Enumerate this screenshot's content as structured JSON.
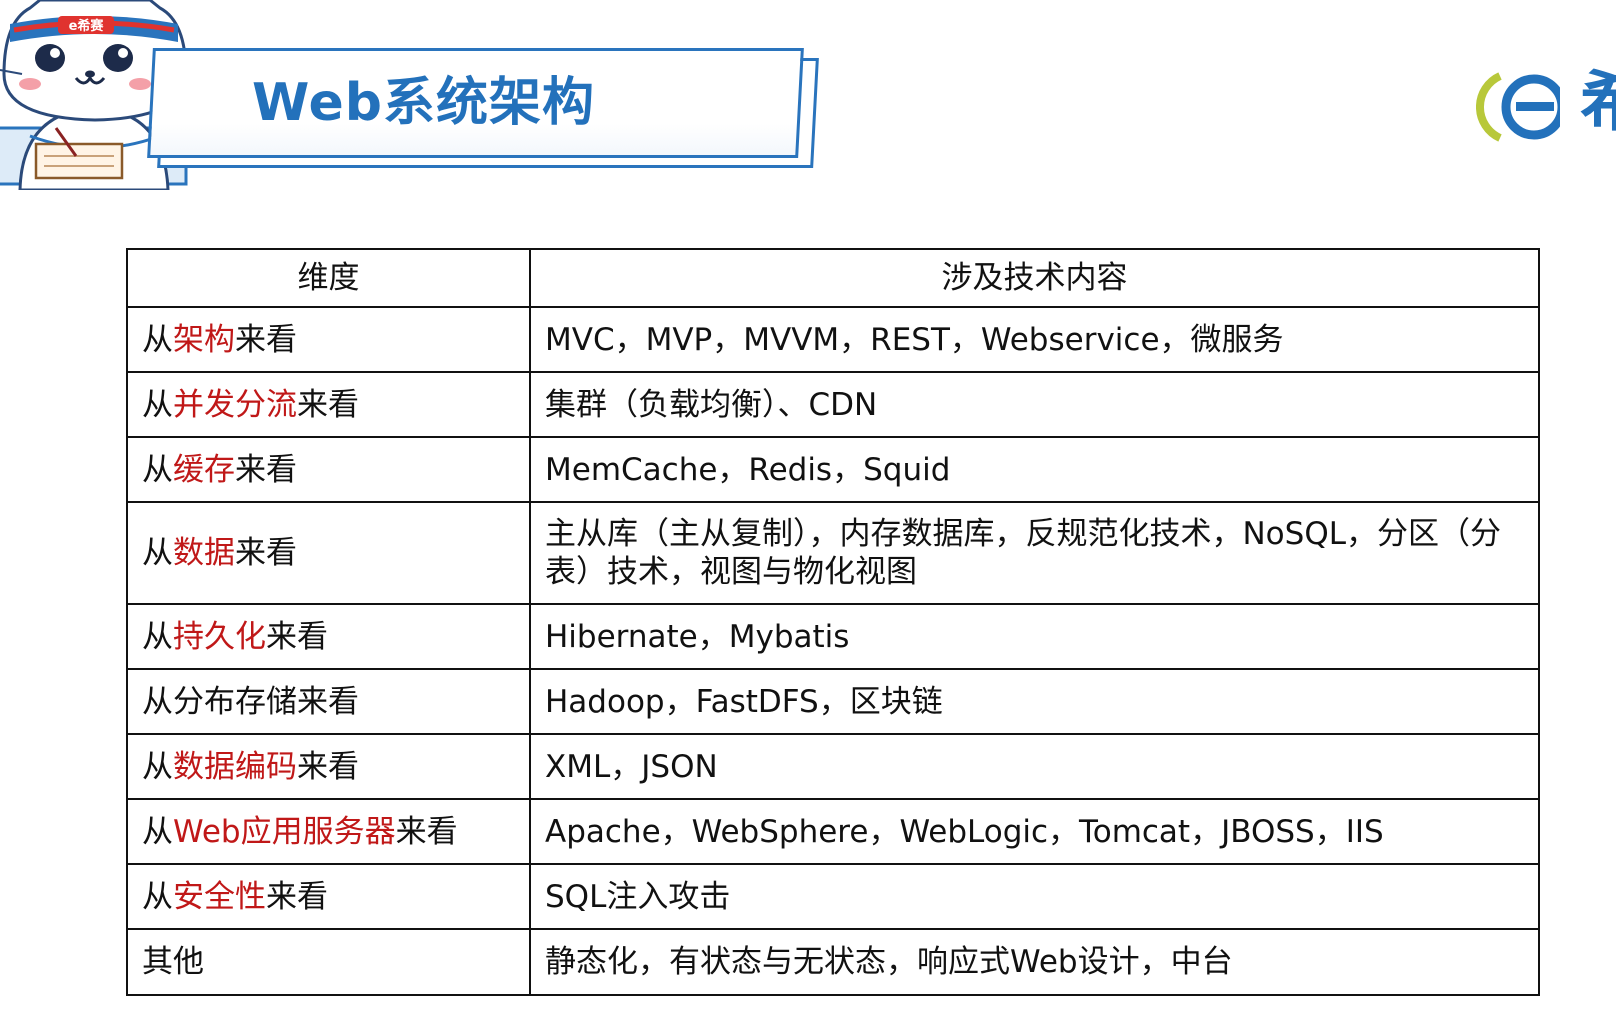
{
  "header": {
    "title": "Web系统架构",
    "mascot_badge": "e希赛",
    "brand_text": "希"
  },
  "colors": {
    "accent_blue": "#2371bb",
    "highlight_red": "#c01818",
    "text": "#111111"
  },
  "table": {
    "headers": [
      "维度",
      "涉及技术内容"
    ],
    "rows": [
      {
        "pre": "从",
        "hl": "架构",
        "post": "来看",
        "content": "MVC，MVP，MVVM，REST，Webservice，微服务"
      },
      {
        "pre": "从",
        "hl": "并发分流",
        "post": "来看",
        "content": "集群（负载均衡）、CDN"
      },
      {
        "pre": "从",
        "hl": "缓存",
        "post": "来看",
        "content": "MemCache，Redis，Squid"
      },
      {
        "pre": "从",
        "hl": "数据",
        "post": "来看",
        "content": "主从库（主从复制），内存数据库，反规范化技术，NoSQL，分区（分表）技术，视图与物化视图"
      },
      {
        "pre": "从",
        "hl": "持久化",
        "post": "来看",
        "content": "Hibernate，Mybatis"
      },
      {
        "pre": "从分布存储来看",
        "hl": "",
        "post": "",
        "content": "Hadoop，FastDFS，区块链"
      },
      {
        "pre": "从",
        "hl": "数据编码",
        "post": "来看",
        "content": "XML，JSON"
      },
      {
        "pre": "从",
        "hl": "Web应用服务器",
        "post": "来看",
        "content": "Apache，WebSphere，WebLogic，Tomcat，JBOSS，IIS"
      },
      {
        "pre": "从",
        "hl": "安全性",
        "post": "来看",
        "content": "SQL注入攻击"
      },
      {
        "pre": "其他",
        "hl": "",
        "post": "",
        "content": "静态化，有状态与无状态，响应式Web设计，中台"
      }
    ]
  }
}
